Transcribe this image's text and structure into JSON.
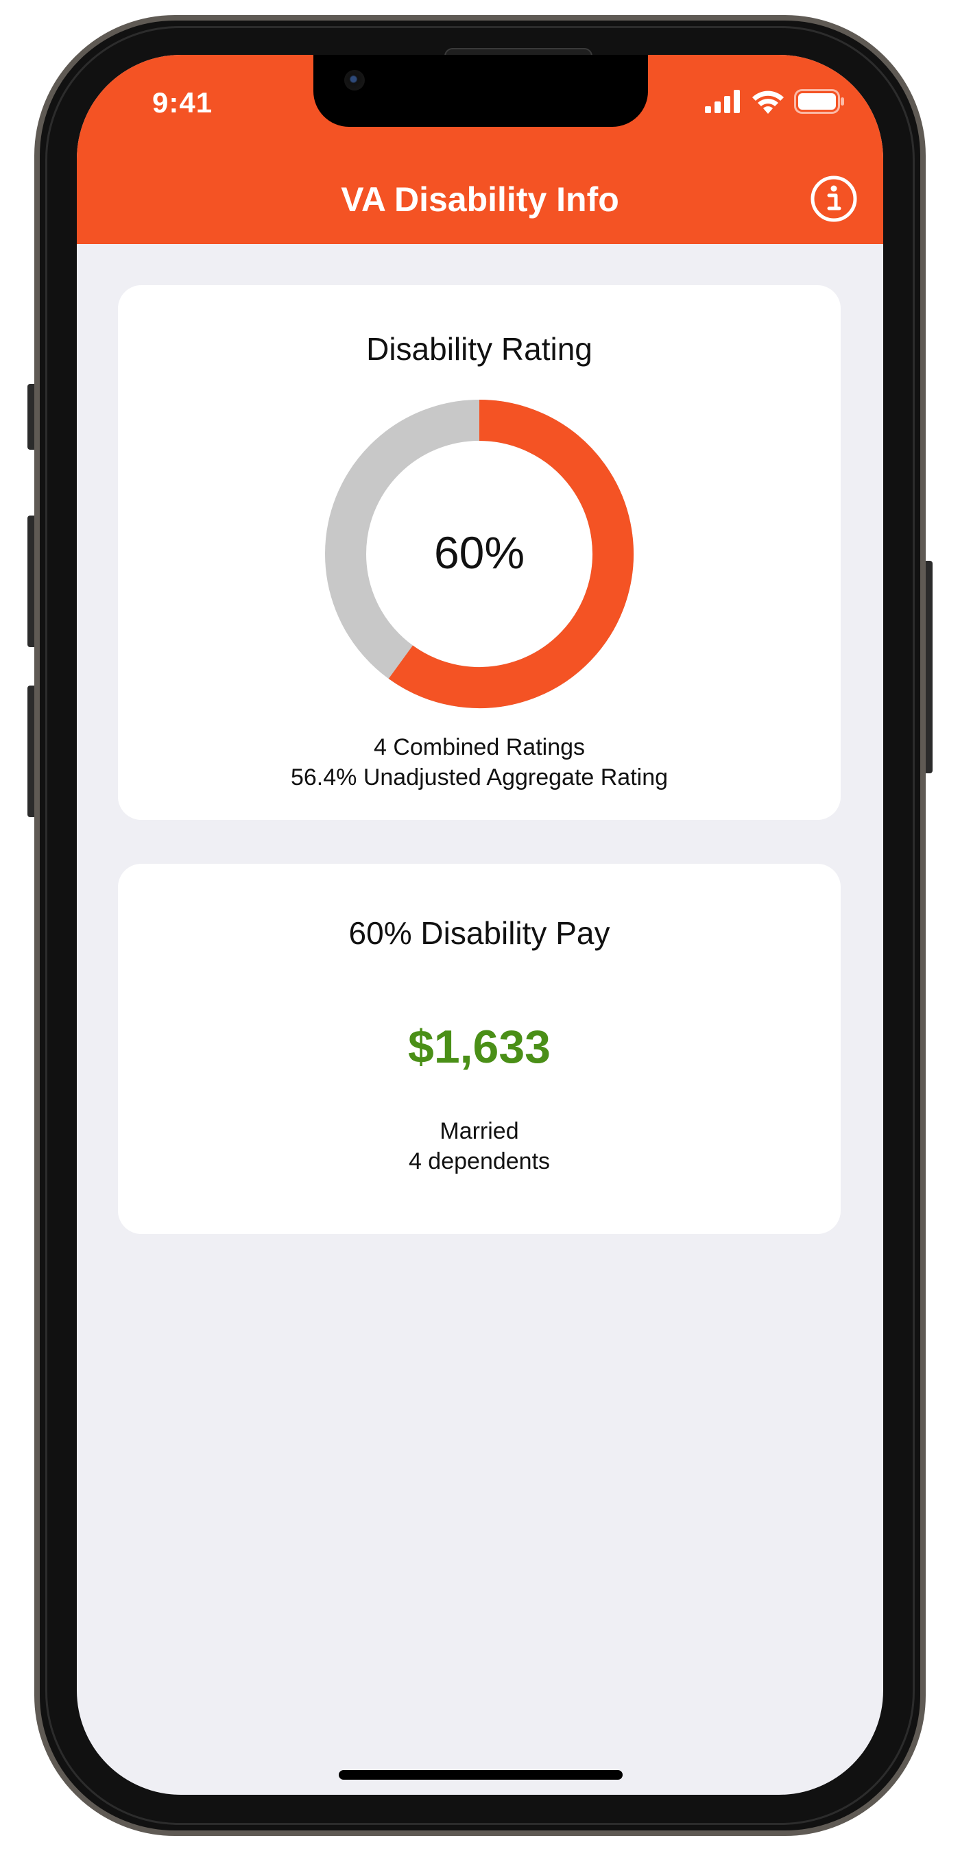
{
  "status_bar": {
    "time": "9:41",
    "signal_icon": "cellular-signal-icon",
    "wifi_icon": "wifi-icon",
    "battery_icon": "battery-icon"
  },
  "nav": {
    "title": "VA Disability Info",
    "info_icon": "info-circle-icon"
  },
  "rating_card": {
    "title": "Disability Rating",
    "percent_label": "60%",
    "percent_value": 60,
    "combined_ratings": "4 Combined Ratings",
    "unadjusted": "56.4% Unadjusted Aggregate Rating"
  },
  "pay_card": {
    "title": "60% Disability Pay",
    "amount": "$1,633",
    "marital_status": "Married",
    "dependents": "4 dependents"
  },
  "colors": {
    "accent": "#f45324",
    "donut_track": "#c8c8c8",
    "pay_green": "#4a8f17",
    "background": "#efeff4"
  }
}
